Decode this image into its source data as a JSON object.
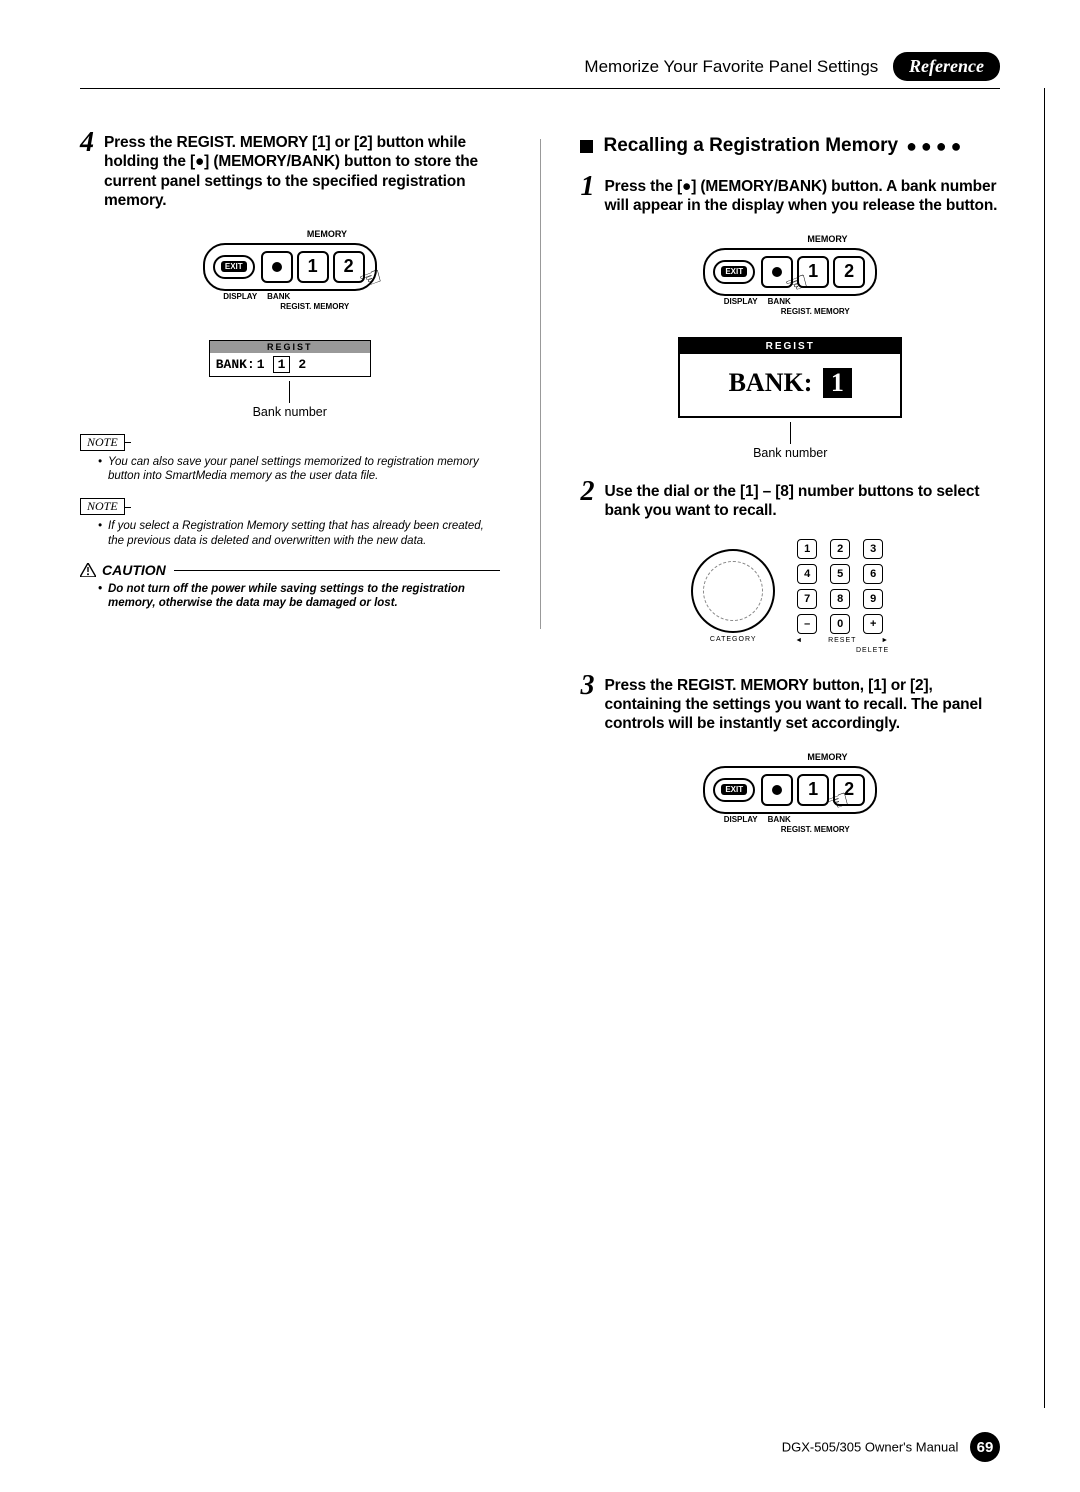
{
  "header": {
    "section_title": "Memorize Your Favorite Panel Settings",
    "reference_badge": "Reference"
  },
  "left": {
    "step4_num": "4",
    "step4_text": "Press the REGIST. MEMORY [1] or [2] button while holding the [●] (MEMORY/BANK) button to store the current panel settings to the specified registration memory.",
    "panel_labels": {
      "memory": "MEMORY",
      "display": "DISPLAY",
      "bank": "BANK",
      "regist_memory": "REGIST. MEMORY",
      "exit": "EXIT",
      "btn1": "1",
      "btn2": "2"
    },
    "lcd_head": "REGIST",
    "lcd_bank_label": "BANK:",
    "lcd_bank_value": "1",
    "lcd_slot1": "1",
    "lcd_slot2": "2",
    "caption_bank_number": "Bank number",
    "note1_label": "NOTE",
    "note1_text": "You can also save your panel settings memorized to registration memory button into SmartMedia memory as the user data file.",
    "note2_label": "NOTE",
    "note2_text": "If you select a Registration Memory setting that has already been created, the previous data is deleted and overwritten with the new data.",
    "caution_label": "CAUTION",
    "caution_text": "Do not turn off the power while saving settings to the registration memory, otherwise the data may be damaged or lost."
  },
  "right": {
    "section_title": "Recalling a Registration Memory",
    "step1_num": "1",
    "step1_text": "Press the [●] (MEMORY/BANK) button. A bank number will appear in the display when you release the button.",
    "caption_bank_number": "Bank number",
    "lcd_head": "REGIST",
    "lcd_bank_label": "BANK:",
    "lcd_bank_value": "1",
    "step2_num": "2",
    "step2_text": "Use the dial or the [1] – [8] number buttons to select bank you want to recall.",
    "keypad": [
      "1",
      "2",
      "3",
      "4",
      "5",
      "6",
      "7",
      "8",
      "9",
      "–",
      "0",
      "+"
    ],
    "kp_category": "CATEGORY",
    "kp_reset": "RESET",
    "kp_delete": "DELETE",
    "step3_num": "3",
    "step3_text": "Press the REGIST. MEMORY button, [1] or [2], containing the settings you want to recall. The panel controls will be instantly set accordingly."
  },
  "footer": {
    "manual": "DGX-505/305  Owner's Manual",
    "page": "69"
  }
}
